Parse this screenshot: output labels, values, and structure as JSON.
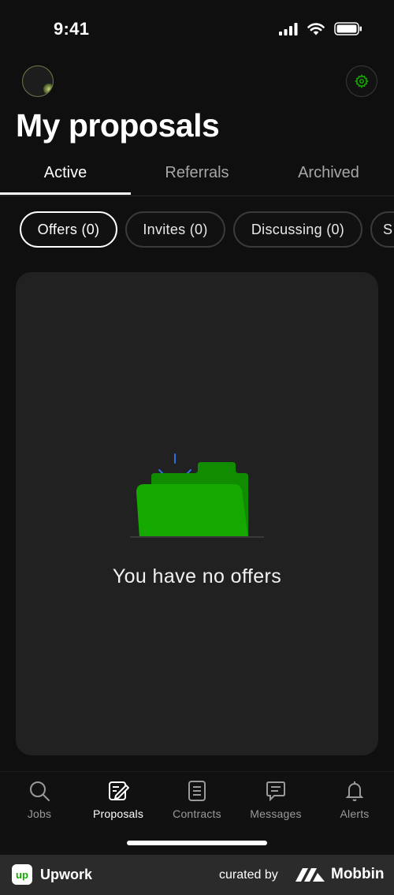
{
  "status_bar": {
    "time": "9:41"
  },
  "header": {
    "title": "My proposals"
  },
  "tabs": [
    {
      "label": "Active",
      "active": true
    },
    {
      "label": "Referrals",
      "active": false
    },
    {
      "label": "Archived",
      "active": false
    }
  ],
  "filters": [
    {
      "label": "Offers (0)",
      "selected": true
    },
    {
      "label": "Invites (0)",
      "selected": false
    },
    {
      "label": "Discussing (0)",
      "selected": false
    },
    {
      "label": "S",
      "selected": false
    }
  ],
  "empty_state": {
    "message": "You have no offers",
    "icon": "folder-icon"
  },
  "nav": [
    {
      "label": "Jobs",
      "icon": "search-icon",
      "active": false
    },
    {
      "label": "Proposals",
      "icon": "proposals-icon",
      "active": true
    },
    {
      "label": "Contracts",
      "icon": "contracts-icon",
      "active": false
    },
    {
      "label": "Messages",
      "icon": "messages-icon",
      "active": false
    },
    {
      "label": "Alerts",
      "icon": "bell-icon",
      "active": false
    }
  ],
  "footer": {
    "app_name": "Upwork",
    "app_badge": "up",
    "curated_by": "curated by",
    "brand": "Mobbin"
  },
  "colors": {
    "accent_green": "#14a800",
    "background": "#0f0f0f",
    "card": "#212121"
  }
}
